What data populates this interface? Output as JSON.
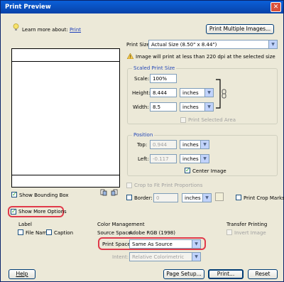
{
  "window": {
    "title": "Print Preview",
    "close": "✕"
  },
  "learn": {
    "prefix": "Learn more about:",
    "link": "Print"
  },
  "buttons": {
    "print_multiple": "Print Multiple Images...",
    "help": "Help",
    "page_setup": "Page Setup...",
    "print": "Print...",
    "reset": "Reset"
  },
  "print_size": {
    "label": "Print Size:",
    "value": "Actual Size (8.50\" x 8.44\")"
  },
  "warning": "Image will print at less than 220 dpi at the selected size",
  "scaled": {
    "legend": "Scaled Print Size",
    "scale_label": "Scale:",
    "scale_value": "100%",
    "height_label": "Height:",
    "height_value": "8.444",
    "height_unit": "inches",
    "width_label": "Width:",
    "width_value": "8.5",
    "width_unit": "inches",
    "print_selected": "Print Selected Area"
  },
  "position": {
    "legend": "Position",
    "top_label": "Top:",
    "top_value": "0.944",
    "top_unit": "inches",
    "left_label": "Left:",
    "left_value": "-0.117",
    "left_unit": "inches",
    "center_label": "Center Image"
  },
  "crop_fit": "Crop to Fit Print Proportions",
  "border": {
    "label": "Border:",
    "value": "0",
    "unit": "inches"
  },
  "print_crop_marks": "Print Crop Marks",
  "show_bounding_box": "Show Bounding Box",
  "show_more_options": "Show More Options",
  "label_section": {
    "title": "Label",
    "file_name": "File Name",
    "caption": "Caption"
  },
  "color_mgmt": {
    "title": "Color Management",
    "source_label": "Source Space:",
    "source_value": "Adobe RGB (1998)",
    "print_space_label": "Print Space:",
    "print_space_value": "Same As Source",
    "intent_label": "Intent:",
    "intent_value": "Relative Colorimetric"
  },
  "transfer": {
    "title": "Transfer Printing",
    "invert": "Invert Image"
  },
  "colors": {
    "highlight": "#e03a4a",
    "titlebar": "#0a5fd8"
  }
}
